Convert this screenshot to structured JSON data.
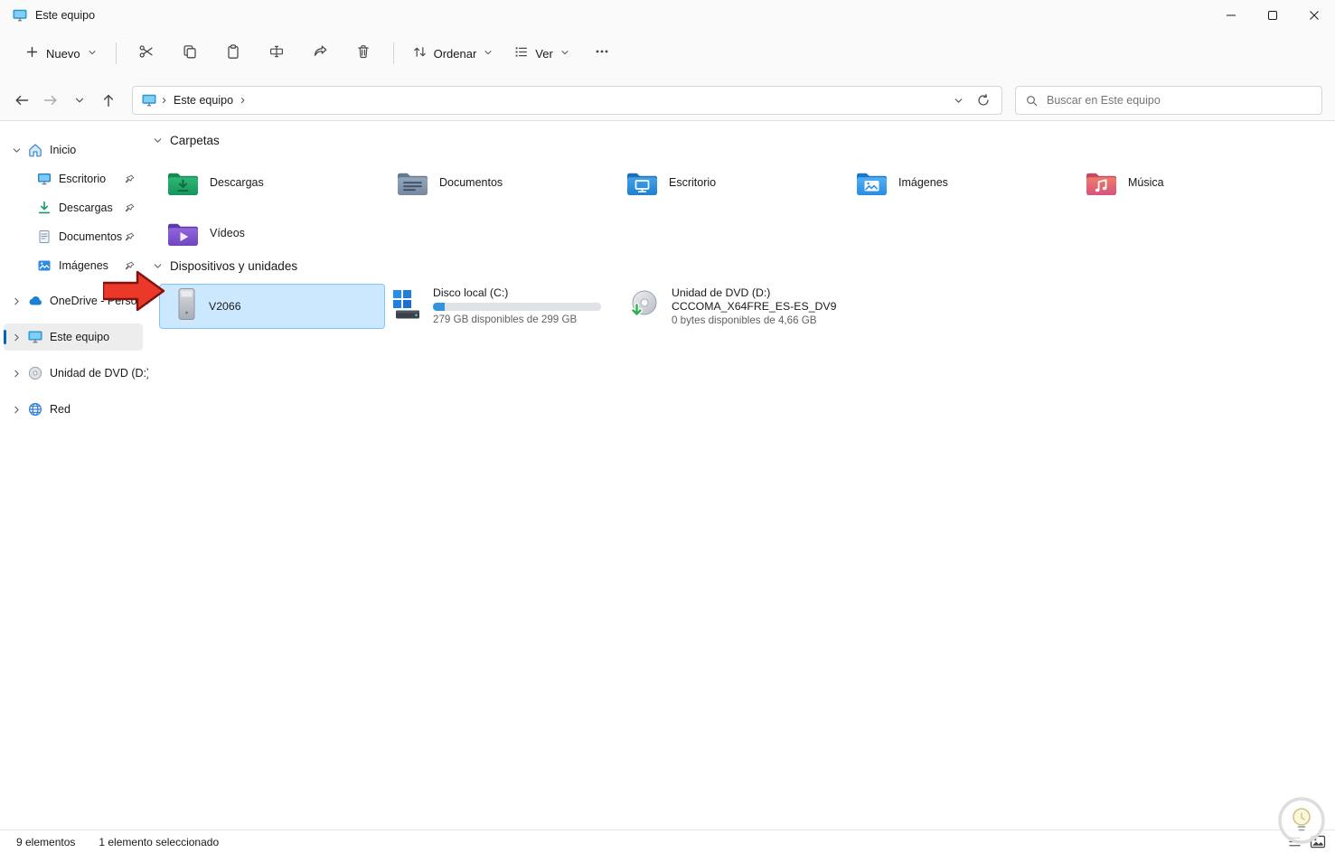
{
  "window": {
    "title": "Este equipo"
  },
  "toolbar": {
    "new_label": "Nuevo",
    "sort_label": "Ordenar",
    "view_label": "Ver"
  },
  "navbar": {
    "breadcrumb": {
      "root": "Este equipo"
    },
    "search_placeholder": "Buscar en Este equipo"
  },
  "sidebar": {
    "items": [
      {
        "label": "Inicio"
      },
      {
        "label": "Escritorio"
      },
      {
        "label": "Descargas"
      },
      {
        "label": "Documentos"
      },
      {
        "label": "Imágenes"
      },
      {
        "label": "OneDrive - Personal"
      },
      {
        "label": "Este equipo"
      },
      {
        "label": "Unidad de DVD (D:)"
      },
      {
        "label": "Red"
      }
    ]
  },
  "content": {
    "folders": {
      "title": "Carpetas",
      "items": [
        {
          "label": "Descargas"
        },
        {
          "label": "Documentos"
        },
        {
          "label": "Escritorio"
        },
        {
          "label": "Imágenes"
        },
        {
          "label": "Música"
        },
        {
          "label": "Vídeos"
        }
      ]
    },
    "devices": {
      "title": "Dispositivos y unidades",
      "usb": {
        "label": "V2066",
        "selected": true
      },
      "local_disk": {
        "label": "Disco local (C:)",
        "free_text": "279 GB disponibles de 299 GB",
        "used_percent": 7
      },
      "dvd": {
        "label": "Unidad de DVD (D:)",
        "volume": "CCCOMA_X64FRE_ES-ES_DV9",
        "free_text": "0 bytes disponibles de 4,66 GB"
      }
    }
  },
  "statusbar": {
    "items_count": "9 elementos",
    "selection_count": "1 elemento seleccionado"
  },
  "colors": {
    "accent": "#0067c0",
    "selection_bg": "#cce8ff",
    "selection_border": "#84c3f5",
    "capacity_fill": "#3393dd"
  }
}
